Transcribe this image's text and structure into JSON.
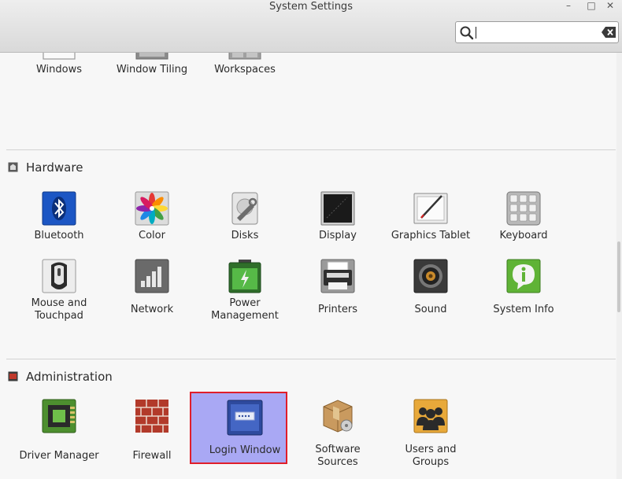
{
  "window": {
    "title": "System Settings",
    "minimize_glyph": "–",
    "maximize_glyph": "□",
    "close_glyph": "✕"
  },
  "search": {
    "value": "",
    "placeholder": ""
  },
  "top_items": [
    {
      "label": "Windows",
      "icon": "windows-icon"
    },
    {
      "label": "Window Tiling",
      "icon": "window-tiling-icon"
    },
    {
      "label": "Workspaces",
      "icon": "workspaces-icon"
    }
  ],
  "sections": {
    "hardware": {
      "title": "Hardware",
      "items": [
        {
          "label": "Bluetooth",
          "icon": "bluetooth-icon"
        },
        {
          "label": "Color",
          "icon": "color-icon"
        },
        {
          "label": "Disks",
          "icon": "disks-icon"
        },
        {
          "label": "Display",
          "icon": "display-icon"
        },
        {
          "label": "Graphics Tablet",
          "icon": "graphics-tablet-icon"
        },
        {
          "label": "Keyboard",
          "icon": "keyboard-icon"
        },
        {
          "label": "Mouse and",
          "label2": "Touchpad",
          "icon": "mouse-icon"
        },
        {
          "label": "Network",
          "icon": "network-icon"
        },
        {
          "label": "Power",
          "label2": "Management",
          "icon": "battery-icon"
        },
        {
          "label": "Printers",
          "icon": "printer-icon"
        },
        {
          "label": "Sound",
          "icon": "speaker-icon"
        },
        {
          "label": "System Info",
          "icon": "info-icon"
        }
      ]
    },
    "administration": {
      "title": "Administration",
      "items": [
        {
          "label": "Driver Manager",
          "icon": "driver-chip-icon"
        },
        {
          "label": "Firewall",
          "icon": "firewall-icon"
        },
        {
          "label": "Login Window",
          "icon": "login-window-icon",
          "selected": true
        },
        {
          "label": "Software",
          "label2": "Sources",
          "icon": "software-package-icon"
        },
        {
          "label": "Users and",
          "label2": "Groups",
          "icon": "users-icon"
        }
      ]
    }
  },
  "colors": {
    "selection_fill": "#a9a8f4",
    "selection_border": "#e01e2a"
  }
}
